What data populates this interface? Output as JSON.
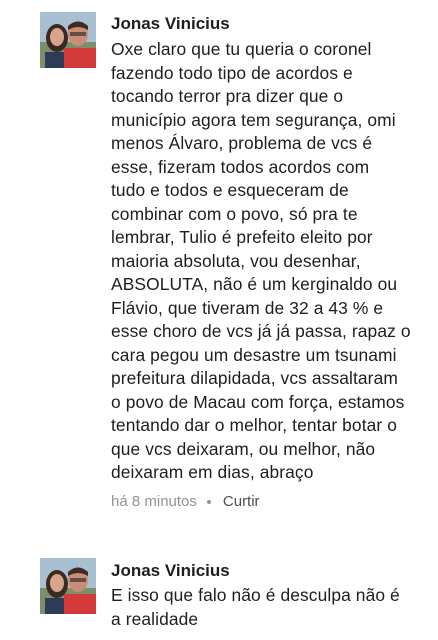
{
  "comments": [
    {
      "author": "Jonas Vinicius",
      "lines": [
        "Oxe claro que tu queria o coronel",
        "fazendo todo tipo de acordos e",
        "tocando terror pra dizer que o",
        "município agora tem segurança, omi",
        "menos Álvaro, problema de vcs é",
        "esse, fizeram todos acordos com",
        "tudo e todos e esqueceram de",
        "combinar com o povo, só pra te",
        "lembrar, Tulio é prefeito eleito por",
        "maioria absoluta, vou desenhar,",
        "ABSOLUTA, não é um kerginaldo ou",
        "Flávio, que tiveram de 32 a 43 % e",
        "esse choro de vcs já já passa, rapaz o",
        "cara pegou um desastre um tsunami",
        "prefeitura dilapidada, vcs assaltaram",
        "o povo de Macau com força, estamos",
        "tentando dar o melhor, tentar botar o",
        "que vcs deixaram, ou melhor, não",
        "deixaram em dias, abraço"
      ],
      "time": "há 8 minutos",
      "like_label": "Curtir"
    },
    {
      "author": "Jonas Vinicius",
      "lines": [
        "E isso que falo não é desculpa não é",
        "a realidade"
      ]
    }
  ],
  "colors": {
    "text": "#1c1e21",
    "meta": "#90949c"
  }
}
